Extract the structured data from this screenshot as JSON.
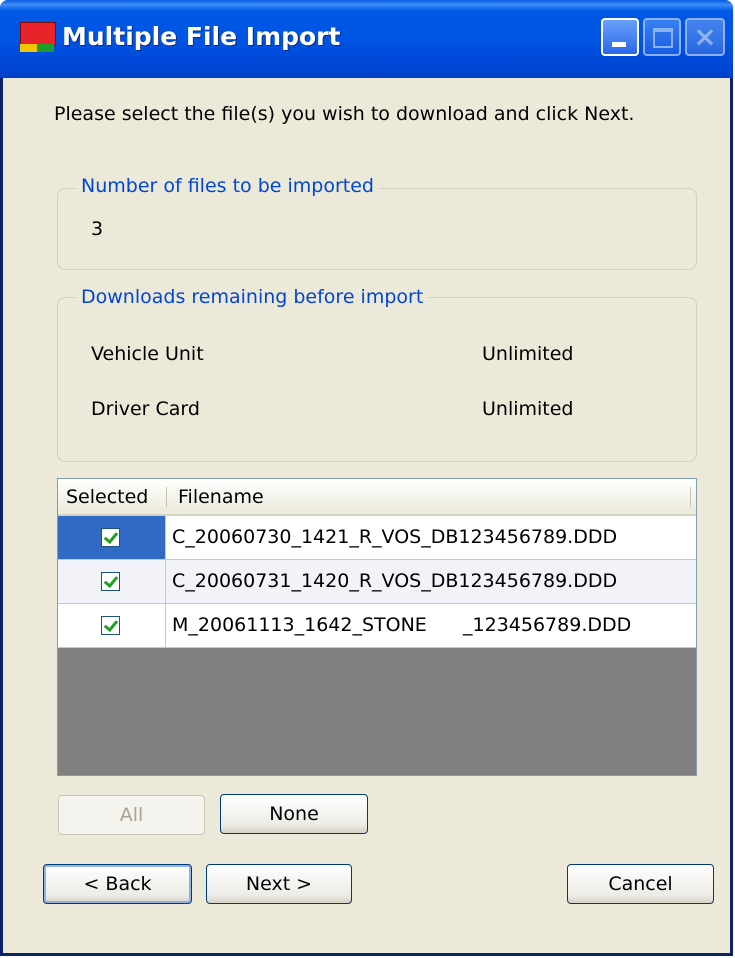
{
  "window": {
    "title": "Multiple File Import"
  },
  "instruction": "Please select the file(s) you wish to download and click Next.",
  "files_group": {
    "label": "Number of files to be imported",
    "count": "3"
  },
  "downloads_group": {
    "label": "Downloads remaining before import",
    "items": [
      {
        "name": "Vehicle Unit",
        "value": "Unlimited"
      },
      {
        "name": "Driver Card",
        "value": "Unlimited"
      }
    ]
  },
  "grid": {
    "columns": [
      "Selected",
      "Filename"
    ],
    "rows": [
      {
        "selected": true,
        "filename": "C_20060730_1421_R_VOS_DB123456789.DDD"
      },
      {
        "selected": true,
        "filename": "C_20060731_1420_R_VOS_DB123456789.DDD"
      },
      {
        "selected": true,
        "filename": "M_20061113_1642_STONE      _123456789.DDD"
      }
    ]
  },
  "buttons": {
    "all": "All",
    "none": "None",
    "back": "< Back",
    "next": "Next >",
    "cancel": "Cancel"
  },
  "icons": [
    "app-icon",
    "minimize-icon",
    "maximize-icon",
    "close-icon",
    "checkbox-checked-icon"
  ],
  "colors": {
    "titlebar": "#0054e3",
    "dialog_bg": "#ece9d8",
    "group_label": "#0046d5",
    "selected_row": "#316ac5",
    "grid_empty": "#808080"
  }
}
